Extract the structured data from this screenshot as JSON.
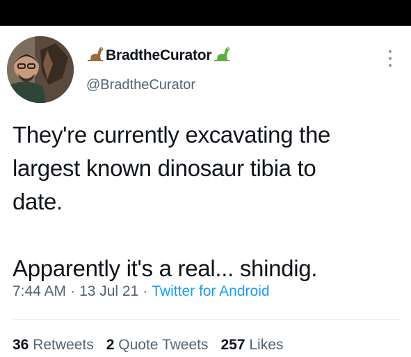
{
  "author": {
    "display_name": "BradtheCurator",
    "handle": "@BradtheCurator"
  },
  "tweet": {
    "text": "They're currently excavating the\nlargest known dinosaur tibia to\ndate.\n\nApparently it's a real... shindig."
  },
  "meta": {
    "time": "7:44 AM",
    "sep1": "·",
    "date": "13 Jul 21",
    "sep2": "·",
    "source": "Twitter for Android"
  },
  "stats": {
    "retweets_count": "36",
    "retweets_label": "Retweets",
    "quotes_count": "2",
    "quotes_label": "Quote Tweets",
    "likes_count": "257",
    "likes_label": "Likes"
  },
  "icons": {
    "left_emoji": "sauropod-icon",
    "right_emoji": "sauropod-icon",
    "more": "more-options-icon"
  },
  "colors": {
    "link": "#1d9bf0",
    "secondary_text": "#536471",
    "primary_text": "#0f1419",
    "dino_green": "#5fae3c",
    "dino_brown": "#9b6a3b"
  }
}
